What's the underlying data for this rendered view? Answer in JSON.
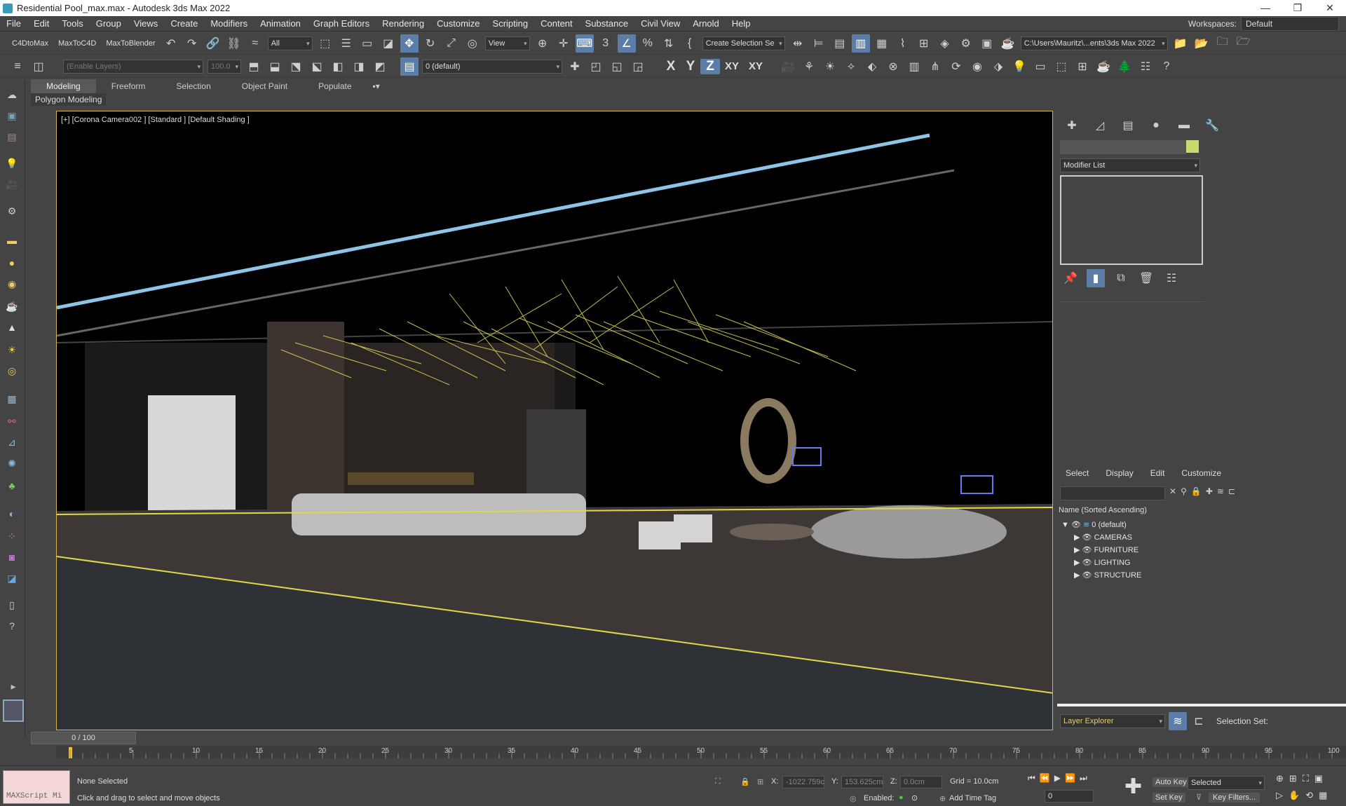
{
  "window": {
    "title": "Residential Pool_max.max - Autodesk 3ds Max 2022",
    "controls": [
      "—",
      "❐",
      "✕"
    ]
  },
  "menu": [
    "File",
    "Edit",
    "Tools",
    "Group",
    "Views",
    "Create",
    "Modifiers",
    "Animation",
    "Graph Editors",
    "Rendering",
    "Customize",
    "Scripting",
    "Content",
    "Substance",
    "Civil View",
    "Arnold",
    "Help"
  ],
  "workspaces": {
    "label": "Workspaces:",
    "value": "Default"
  },
  "toolbar1": {
    "plugins": [
      "C4DtoMax",
      "MaxToC4D",
      "MaxToBlender"
    ],
    "filter": "All",
    "refcoord": "View",
    "selection_set": "Create Selection Se",
    "path": "C:\\Users\\Mauritz\\...ents\\3ds Max 2022"
  },
  "toolbar2": {
    "enable_layers": "(Enable Layers)",
    "value": "100.0",
    "layer": "0 (default)",
    "axes": [
      "X",
      "Y",
      "Z",
      "XY",
      "XY"
    ]
  },
  "ribbon": {
    "tabs": [
      "Modeling",
      "Freeform",
      "Selection",
      "Object Paint",
      "Populate"
    ],
    "active": "Modeling",
    "sub": "Polygon Modeling"
  },
  "viewport": {
    "label": "[+] [Corona Camera002 ] [Standard ] [Default Shading ]"
  },
  "command_panel": {
    "modifier_list": "Modifier List",
    "color": "#c6dc6e"
  },
  "scene_explorer": {
    "menu": [
      "Select",
      "Display",
      "Edit",
      "Customize"
    ],
    "sort": "Name (Sorted Ascending)",
    "root": "0 (default)",
    "layers": [
      "CAMERAS",
      "FURNITURE",
      "LIGHTING",
      "STRUCTURE"
    ],
    "footer_label": "Layer Explorer",
    "selection_set": "Selection Set:"
  },
  "timeline": {
    "frame": "0 / 100",
    "ticks": [
      "5",
      "10",
      "15",
      "20",
      "25",
      "30",
      "35",
      "40",
      "45",
      "50",
      "55",
      "60",
      "65",
      "70",
      "75",
      "80",
      "85",
      "90",
      "95",
      "100"
    ]
  },
  "status": {
    "maxscript": "MAXScript Mi",
    "selected": "None Selected",
    "prompt": "Click and drag to select and move objects",
    "x_label": "X:",
    "x_value": "-1022.759c",
    "y_label": "Y:",
    "y_value": "153.625cm",
    "z_label": "Z:",
    "z_value": "0.0cm",
    "grid": "Grid = 10.0cm",
    "enabled": "Enabled:",
    "add_time_tag": "Add Time Tag",
    "auto_key": "Auto Key",
    "set_key": "Set Key",
    "key_mode": "Selected",
    "key_filters": "Key Filters...",
    "frame_field": "0"
  }
}
